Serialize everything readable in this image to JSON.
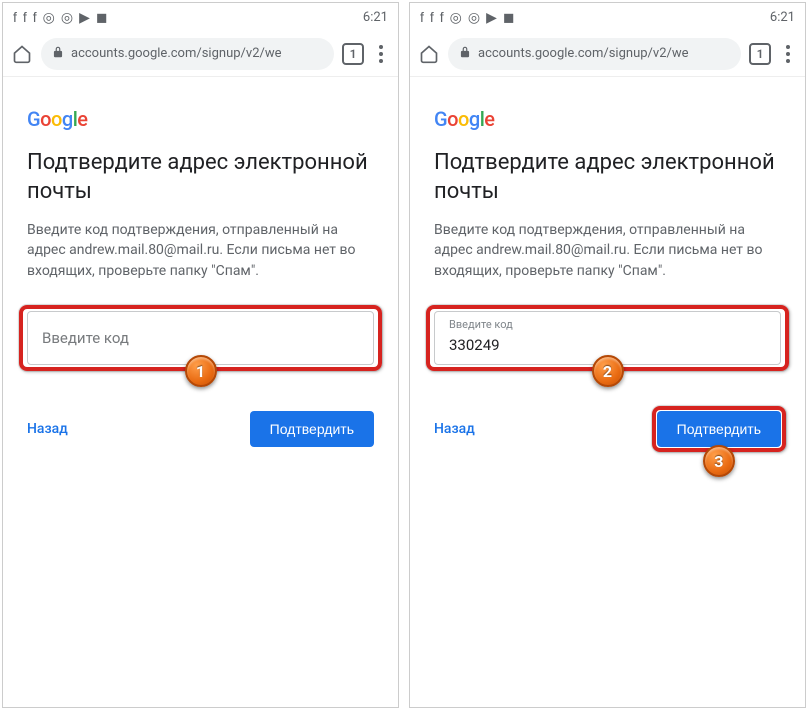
{
  "status": {
    "time": "6:21"
  },
  "browser": {
    "url": "accounts.google.com/signup/v2/we",
    "tab_count": "1"
  },
  "logo": "Google",
  "page": {
    "title": "Подтвердите адрес электронной почты",
    "description": "Введите код подтверждения, отправленный на адрес andrew.mail.80@mail.ru. Если письма нет во входящих, проверьте папку \"Спам\"."
  },
  "field": {
    "label": "Введите код",
    "value_filled": "330249"
  },
  "actions": {
    "back": "Назад",
    "confirm": "Подтвердить"
  },
  "callouts": {
    "n1": "1",
    "n2": "2",
    "n3": "3"
  }
}
